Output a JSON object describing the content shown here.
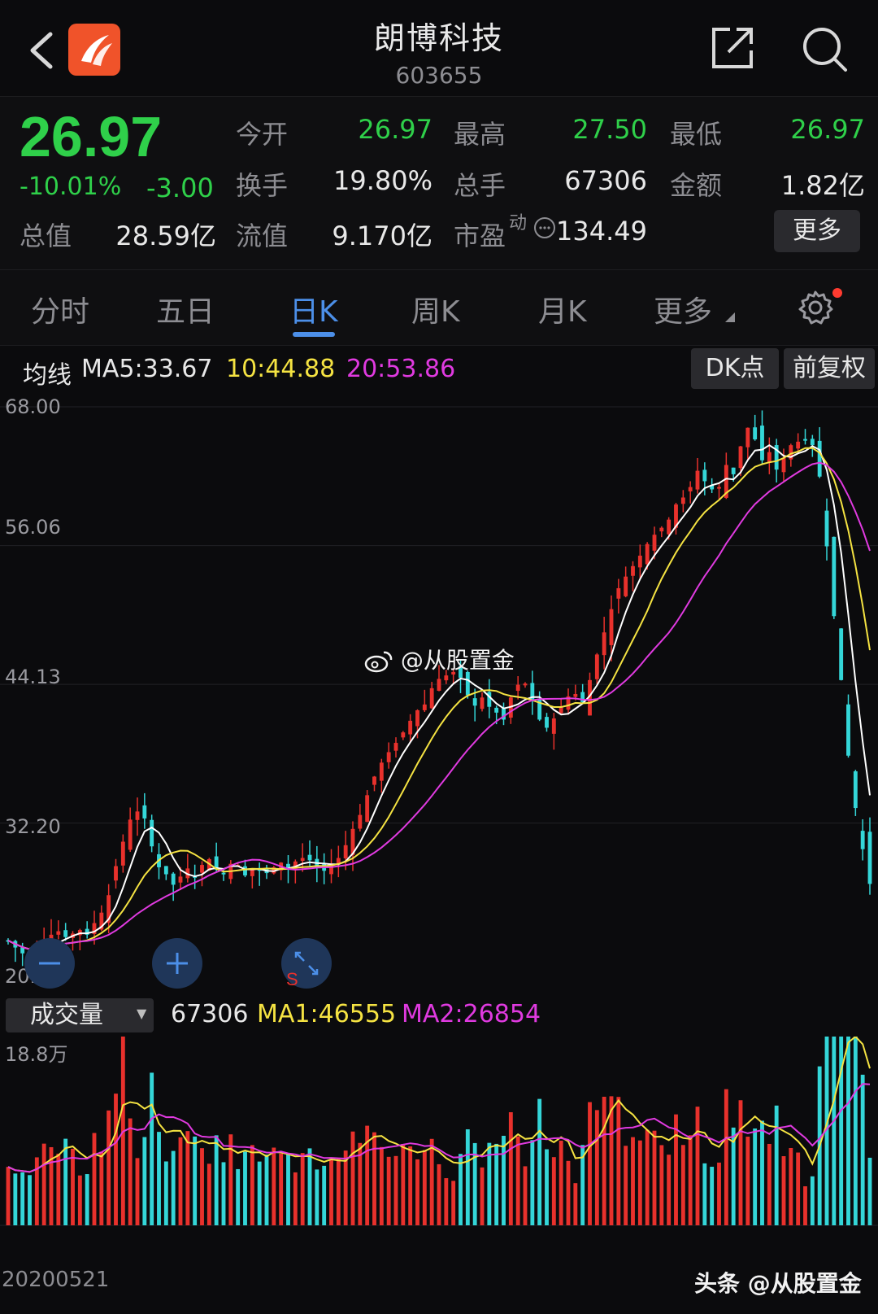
{
  "header": {
    "title": "朗博科技",
    "code": "603655"
  },
  "quote": {
    "price": "26.97",
    "change_pct": "-10.01%",
    "change": "-3.00",
    "open_label": "今开",
    "open": "26.97",
    "high_label": "最高",
    "high": "27.50",
    "low_label": "最低",
    "low": "26.97",
    "turnover_label": "换手",
    "turnover": "19.80%",
    "volume_label": "总手",
    "volume": "67306",
    "amount_label": "金额",
    "amount": "1.82亿",
    "mcap_label": "总值",
    "mcap": "28.59亿",
    "float_label": "流值",
    "float": "9.170亿",
    "pe_label": "市盈",
    "pe_sup": "动",
    "pe": "134.49",
    "more_label": "更多"
  },
  "tabs": {
    "items": [
      "分时",
      "五日",
      "日K",
      "周K",
      "月K",
      "更多"
    ],
    "active": "日K"
  },
  "ma": {
    "label": "均线",
    "ma5": "MA5:33.67",
    "ma10": "10:44.88",
    "ma20": "20:53.86",
    "dk_label": "DK点",
    "adjust_label": "前复权"
  },
  "chart_data": [
    {
      "type": "candlestick",
      "title": "",
      "y_ticks": [
        "68.00",
        "56.06",
        "44.13",
        "32.20",
        "20.28"
      ],
      "ylim": [
        20.28,
        68.0
      ],
      "series": [
        {
          "name": "MA5",
          "color": "#ffffff"
        },
        {
          "name": "MA10",
          "color": "#f5e342"
        },
        {
          "name": "MA20",
          "color": "#e03ae0"
        }
      ],
      "x_start_label": "20200521",
      "last_close": 26.97,
      "closes": [
        22.1,
        21.5,
        21.0,
        20.8,
        21.3,
        21.9,
        22.6,
        22.9,
        22.4,
        22.7,
        23.0,
        22.6,
        23.6,
        24.5,
        26.0,
        28.5,
        30.6,
        32.5,
        33.2,
        32.6,
        30.2,
        28.4,
        27.8,
        26.9,
        27.6,
        28.3,
        27.5,
        28.6,
        29.1,
        28.2,
        27.9,
        28.7,
        28.6,
        27.7,
        28.2,
        28.1,
        27.9,
        28.4,
        28.8,
        28.3,
        28.9,
        29.2,
        29.0,
        28.4,
        28.1,
        28.6,
        29.2,
        30.3,
        31.7,
        32.9,
        34.6,
        36.2,
        37.4,
        38.3,
        39.1,
        40.0,
        41.0,
        41.9,
        42.4,
        43.8,
        44.6,
        44.9,
        45.2,
        44.7,
        43.2,
        42.3,
        43.0,
        42.2,
        41.7,
        41.1,
        43.0,
        44.1,
        44.2,
        42.8,
        41.1,
        40.4,
        41.2,
        42.2,
        43.1,
        43.3,
        42.6,
        44.5,
        46.7,
        48.6,
        50.6,
        52.4,
        53.4,
        54.3,
        55.2,
        56.2,
        57.0,
        57.6,
        58.3,
        59.6,
        60.2,
        61.1,
        62.5,
        61.6,
        60.9,
        61.1,
        63.0,
        62.2,
        64.6,
        66.2,
        65.2,
        63.4,
        64.1,
        62.6,
        63.6,
        64.7,
        65.0,
        65.1,
        64.7,
        62.0,
        56.0,
        50.0,
        44.5,
        38.0,
        33.5,
        29.96,
        26.97
      ]
    },
    {
      "type": "bar",
      "title": "",
      "name": "成交量",
      "value_label": "67306",
      "ma1": "MA1:46555",
      "ma2": "MA2:26854",
      "y_max_label": "18.8万",
      "ylim": [
        0,
        188000
      ]
    }
  ],
  "watermarks": {
    "mid": "@从股置金",
    "bottom": "头条 @从股置金"
  },
  "colors": {
    "up": "#e8312c",
    "down": "#34d6d8",
    "accent": "#4c8fe8",
    "price_down": "#2fd04a"
  },
  "icons": [
    "chevron-left-icon",
    "app-logo-icon",
    "share-icon",
    "search-icon",
    "gear-icon",
    "zoom-out-icon",
    "zoom-in-icon",
    "fullscreen-icon",
    "weibo-icon"
  ]
}
